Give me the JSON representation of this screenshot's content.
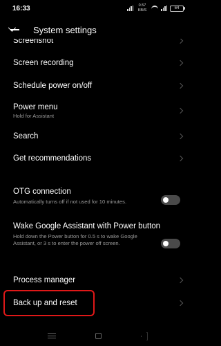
{
  "status_bar": {
    "time": "16:33",
    "speed": "0.57 KB/S",
    "battery": "64"
  },
  "header": {
    "title": "System settings"
  },
  "rows": [
    {
      "id": "screenshot",
      "title": "Screenshot",
      "type": "chevron"
    },
    {
      "id": "screen-recording",
      "title": "Screen recording",
      "type": "chevron"
    },
    {
      "id": "schedule-power",
      "title": "Schedule power on/off",
      "type": "chevron"
    },
    {
      "id": "power-menu",
      "title": "Power menu",
      "subtitle": "Hold for Assistant",
      "type": "chevron"
    },
    {
      "id": "search",
      "title": "Search",
      "type": "chevron"
    },
    {
      "id": "get-recommendations",
      "title": "Get recommendations",
      "type": "chevron"
    },
    {
      "id": "otg-connection",
      "title": "OTG connection",
      "subtitle": "Automatically turns off if not used for 10 minutes.",
      "type": "toggle",
      "on": false
    },
    {
      "id": "wake-google-assistant",
      "title": "Wake Google Assistant with Power button",
      "subtitle": "Hold down the Power button for 0.5 s to wake Google Assistant, or 3 s to enter the power off screen.",
      "type": "toggle",
      "on": false
    },
    {
      "id": "process-manager",
      "title": "Process manager",
      "type": "chevron"
    },
    {
      "id": "back-up-and-reset",
      "title": "Back up and reset",
      "type": "chevron"
    }
  ],
  "colors": {
    "background": "#000000",
    "highlight": "#e01818",
    "toggle_off": "#4a4a4a"
  }
}
